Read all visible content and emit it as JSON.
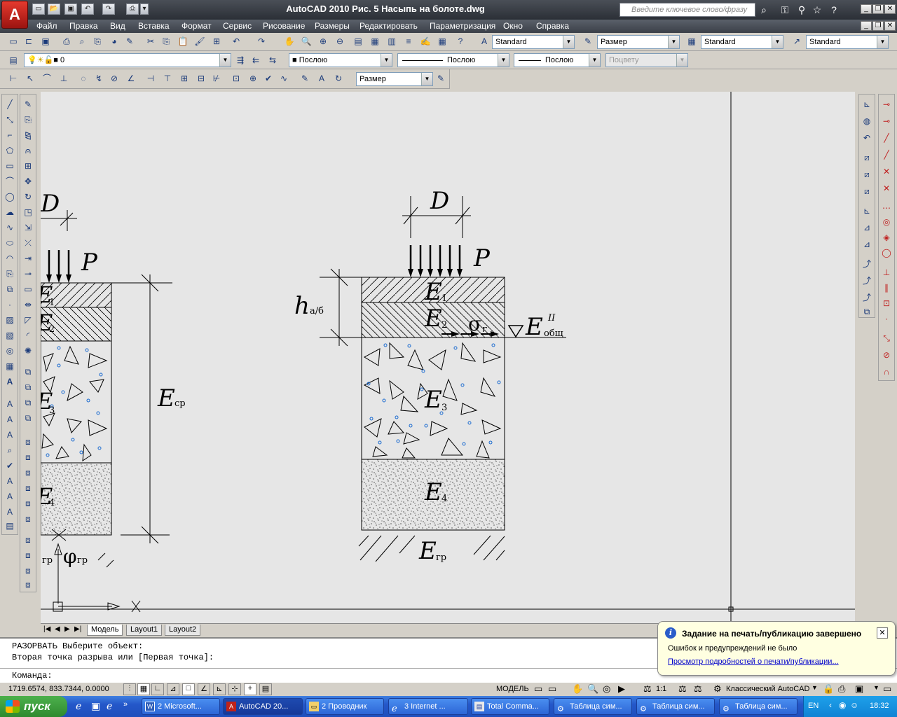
{
  "app": {
    "logo": "A",
    "title": "AutoCAD 2010    Рис. 5 Насыпь на болоте.dwg"
  },
  "help_search": {
    "placeholder": "Введите ключевое слово/фразу"
  },
  "menu": [
    "Файл",
    "Правка",
    "Вид",
    "Вставка",
    "Формат",
    "Сервис",
    "Рисование",
    "Размеры",
    "Редактировать",
    "Параметризация",
    "Окно",
    "Справка"
  ],
  "styles": {
    "text_style": "Standard",
    "dim_style": "Размер",
    "table_style": "Standard",
    "multileader_style": "Standard"
  },
  "layers": {
    "current": "0",
    "color": "Послою",
    "linetype": "Послою",
    "lineweight": "Послою",
    "plotstyle": "Поцвету"
  },
  "dim_toolbar": {
    "dim_style": "Размер"
  },
  "drawing": {
    "left_fig": {
      "D": "D",
      "P": "P",
      "E1": "E",
      "E1s": "1",
      "E2": "E",
      "E2s": "2",
      "E3": "E",
      "E3s": "3",
      "E4": "E",
      "E4s": "4",
      "Ecp": "E",
      "Ecps": "ср",
      "phi": "φ",
      "phis": "гр",
      "cgr": "гр"
    },
    "right_fig": {
      "D": "D",
      "P": "P",
      "h": "h",
      "hs": "а/б",
      "E1": "E",
      "E1s": "1",
      "E2": "E",
      "E2s": "2",
      "sigma": "σ",
      "sigmas": "r",
      "Eob": "E",
      "Eobsup": "II",
      "Eobs": "общ",
      "E3": "E",
      "E3s": "3",
      "E4": "E",
      "E4s": "4",
      "Egr": "E",
      "Egrs": "гр"
    }
  },
  "layout_tabs": [
    "Модель",
    "Layout1",
    "Layout2"
  ],
  "command_history": [
    "РАЗОРВАТЬ Выберите объект:",
    "Вторая точка разрыва или [Первая точка]:"
  ],
  "command_prompt": "Команда:",
  "status": {
    "coords": "1719.6574, 833.7344, 0.0000",
    "model": "МОДЕЛЬ",
    "scale": "1:1",
    "workspace": "Классический AutoCAD"
  },
  "notification": {
    "title": "Задание на печать/публикацию завершено",
    "message": "Ошибок и предупреждений не было",
    "link": "Просмотр подробностей о печати/публикации..."
  },
  "taskbar": {
    "start": "пуск",
    "tasks": [
      "2 Microsoft...",
      "AutoCAD 20...",
      "2 Проводник",
      "3 Internet ...",
      "Total Comma...",
      "Таблица сим...",
      "Таблица сим...",
      "Таблица сим..."
    ],
    "lang": "EN",
    "clock": "18:32"
  },
  "colors": {
    "accent": "#d32a1e",
    "drawing_bg": "#e6e6e6",
    "link": "#0000cc",
    "circles": "#1a6ad0"
  }
}
